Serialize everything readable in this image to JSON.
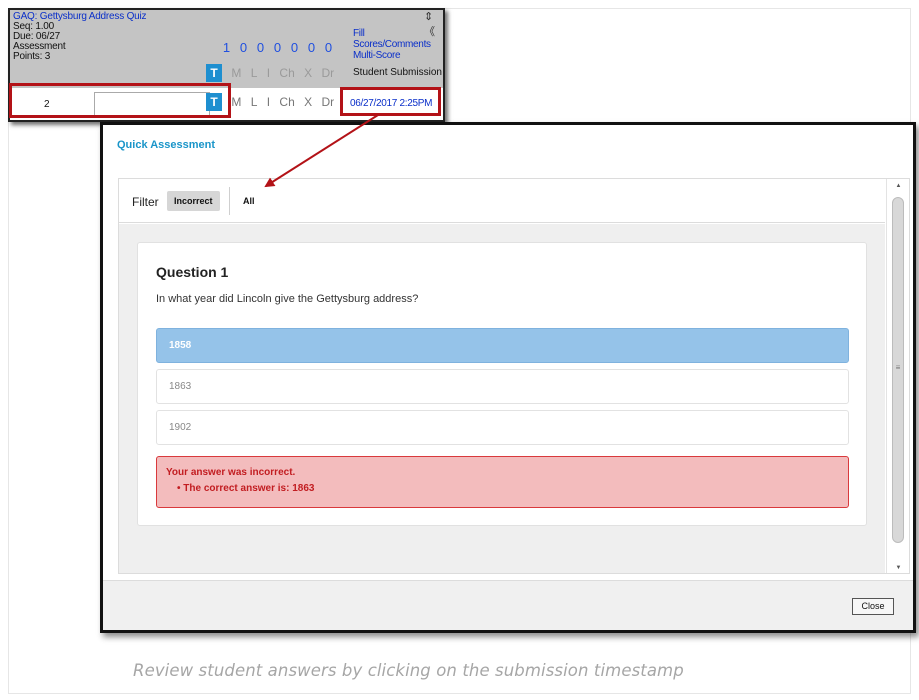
{
  "gradebook": {
    "assignment_title": "GAQ: Gettysburg Address Quiz",
    "seq": "Seq: 1.00",
    "due": "Due: 06/27",
    "category": "Assessment",
    "points": "Points: 3",
    "sort_glyph": "⇕ 《",
    "fill_scores_link": "Fill Scores/Comments",
    "multi_score_link": "Multi-Score",
    "counts": [
      "1",
      "0",
      "0",
      "0",
      "0",
      "0",
      "0"
    ],
    "flag_codes": [
      "T",
      "M",
      "L",
      "I",
      "Ch",
      "X",
      "Dr"
    ],
    "student_submission_label": "Student Submission",
    "row": {
      "score": "2",
      "comment": "",
      "flag_codes": [
        "T",
        "M",
        "L",
        "I",
        "Ch",
        "X",
        "Dr"
      ],
      "submission_time": "06/27/2017 2:25PM"
    }
  },
  "modal": {
    "title": "Quick Assessment",
    "filter": {
      "label": "Filter",
      "options": [
        "Incorrect",
        "All"
      ],
      "selected": "Incorrect"
    },
    "question": {
      "title": "Question 1",
      "text": "In what year did Lincoln give the Gettysburg address?",
      "options": [
        "1858",
        "1863",
        "1902"
      ],
      "selected": "1858",
      "feedback_title": "Your answer was incorrect.",
      "feedback_detail": "• The correct answer is: 1863"
    },
    "close_label": "Close"
  },
  "caption": "Review student answers by clicking on the submission timestamp",
  "colors": {
    "highlight_red": "#b31217",
    "link_blue": "#0a2fc9",
    "selected_option": "#95c3e9",
    "error_bg": "#f3bcbd",
    "error_text": "#c21d21",
    "title_blue": "#1a95c9"
  }
}
